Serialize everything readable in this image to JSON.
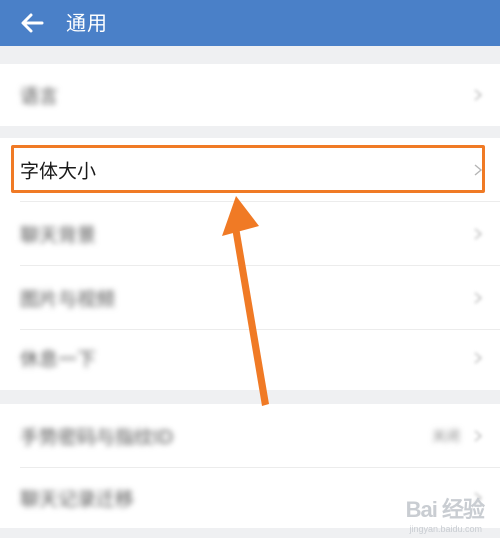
{
  "header": {
    "title": "通用",
    "back_icon": "arrow-left-icon",
    "background": "#4a80c8"
  },
  "settings": {
    "group1": [
      {
        "label": "语言",
        "blurred": true
      }
    ],
    "group2": [
      {
        "label": "字体大小",
        "blurred": false,
        "highlighted": true
      },
      {
        "label": "聊天背景",
        "blurred": true
      },
      {
        "label": "图片与视频",
        "blurred": true
      },
      {
        "label": "休息一下",
        "blurred": true
      }
    ],
    "group3": [
      {
        "label": "手势密码与指纹ID",
        "value": "关闭",
        "blurred": true
      },
      {
        "label": "聊天记录迁移",
        "blurred": true
      }
    ]
  },
  "annotation": {
    "color": "#f07a25"
  },
  "watermark": {
    "text": "Bai 经验",
    "url": "jingyan.baidu.com"
  }
}
